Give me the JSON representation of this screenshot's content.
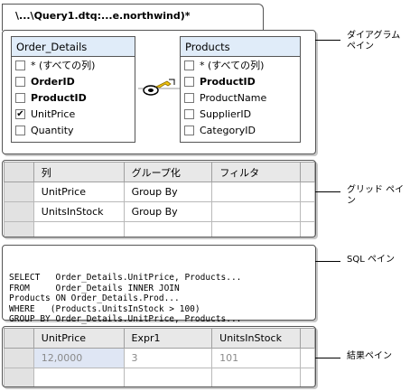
{
  "document_tab": {
    "title": "\\...\\Query1.dtq:...e.northwind)*"
  },
  "diagram": {
    "order_details": {
      "title": "Order_Details",
      "columns": [
        {
          "label": "* (すべての列)",
          "checked": false,
          "bold": false
        },
        {
          "label": "OrderID",
          "checked": false,
          "bold": true
        },
        {
          "label": "ProductID",
          "checked": false,
          "bold": true
        },
        {
          "label": "UnitPrice",
          "checked": true,
          "bold": false
        },
        {
          "label": "Quantity",
          "checked": false,
          "bold": false
        }
      ]
    },
    "products": {
      "title": "Products",
      "columns": [
        {
          "label": "* (すべての列)",
          "checked": false,
          "bold": false
        },
        {
          "label": "ProductID",
          "checked": false,
          "bold": true
        },
        {
          "label": "ProductName",
          "checked": false,
          "bold": false
        },
        {
          "label": "SupplierID",
          "checked": false,
          "bold": false
        },
        {
          "label": "CategoryID",
          "checked": false,
          "bold": false
        }
      ]
    },
    "join_icon": "key-join-icon"
  },
  "grid": {
    "headers": [
      "列",
      "グループ化",
      "フィルタ"
    ],
    "rows": [
      [
        "UnitPrice",
        "Group By",
        ""
      ],
      [
        "UnitsInStock",
        "Group By",
        ""
      ]
    ]
  },
  "sql": {
    "lines": [
      "SELECT   Order_Details.UnitPrice, Products...",
      "FROM     Order_Details INNER JOIN",
      "Products ON Order_Details.Prod...",
      "WHERE   (Products.UnitsInStock > 100)",
      "GROUP BY Order_Details.UnitPrice, Products..."
    ]
  },
  "results": {
    "headers": [
      "UnitPrice",
      "Expr1",
      "UnitsInStock"
    ],
    "rows": [
      [
        "12,0000",
        "3",
        "101"
      ]
    ]
  },
  "callouts": {
    "diagram_pane": "ダイアグラム\nペイン",
    "grid_pane": "グリッド ペイン",
    "sql_pane": "SQL ペイン",
    "results_pane": "結果ペイン"
  },
  "colors": {
    "table_title_bg": "#e0ecf9",
    "selected_cell_bg": "#dfe6f4",
    "pane_border": "#555555"
  }
}
